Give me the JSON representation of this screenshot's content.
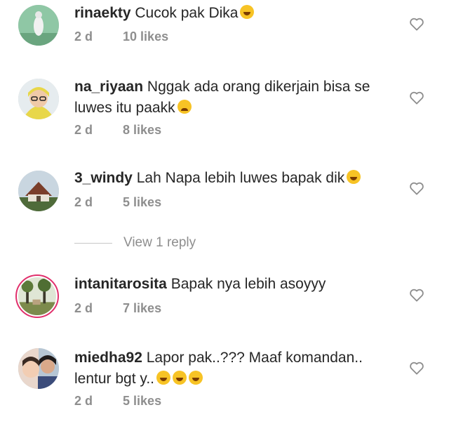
{
  "comments": [
    {
      "username": "rinaekty",
      "text": "Cucok pak Dika",
      "time": "2 d",
      "likes": "10 likes"
    },
    {
      "username": "na_riyaan",
      "text": "Nggak ada orang dikerjain bisa se luwes itu paakk",
      "time": "2 d",
      "likes": "8 likes"
    },
    {
      "username": "3_windy",
      "text": "Lah Napa lebih luwes bapak dik",
      "time": "2 d",
      "likes": "5 likes"
    },
    {
      "username": "intanitarosita",
      "text": "Bapak nya lebih asoyyy",
      "time": "2 d",
      "likes": "7 likes"
    },
    {
      "username": "miedha92",
      "text": "Lapor pak..??? Maaf komandan.. lentur bgt y..",
      "time": "2 d",
      "likes": "5 likes"
    }
  ],
  "view_replies_label": "View 1 reply",
  "icons": {
    "like": "heart-outline-icon",
    "emoji_laugh": "tears-of-joy-emoji",
    "emoji_sad": "crying-face-emoji"
  },
  "colors": {
    "meta_text": "#8e8e8e",
    "story_ring": "#e1306c",
    "text": "#262626"
  }
}
